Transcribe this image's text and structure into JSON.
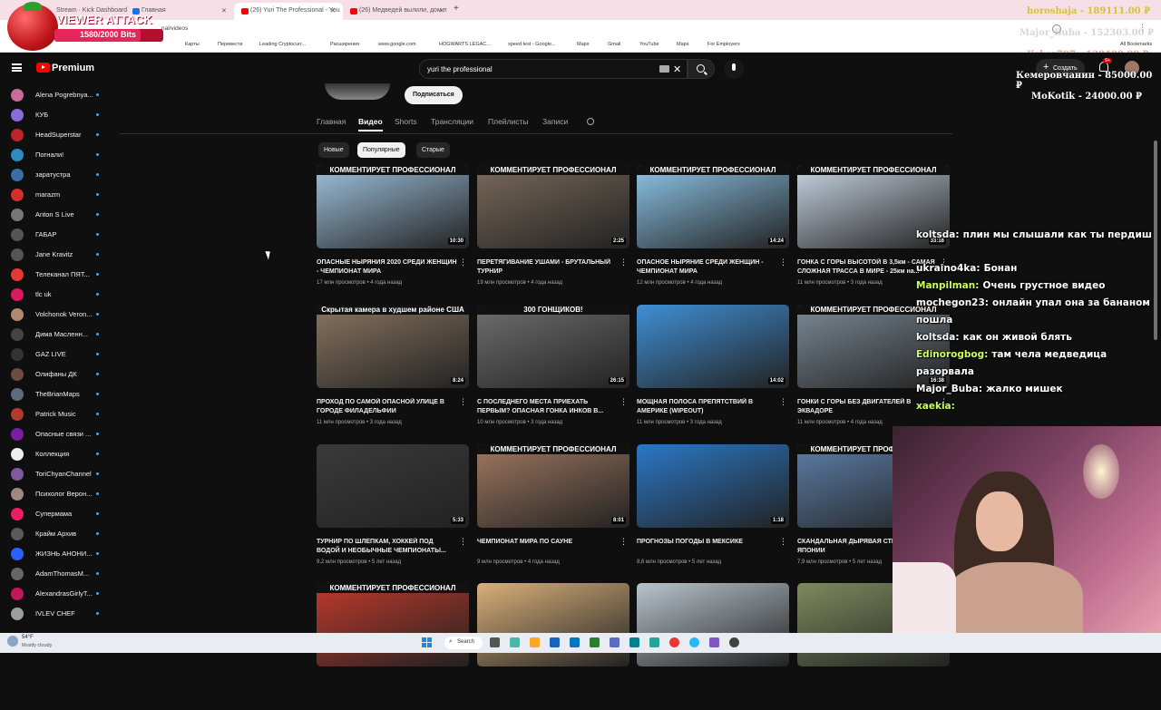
{
  "browser": {
    "tabs": [
      {
        "label": "Stream · Kick Dashboard",
        "active": false
      },
      {
        "label": "Главная",
        "active": false
      },
      {
        "label": "(26) Yuri The Professional - You",
        "active": true
      },
      {
        "label": "(26) Медведей вылили, дом п",
        "active": false
      }
    ],
    "url": "nal/videos",
    "bookmarks": [
      "Карты",
      "Перевести",
      "Leading Cryptocurr...",
      "Расширения",
      "www.google.com",
      "HOGWARTS LEGAC...",
      "speed test - Google...",
      "Maps",
      "Gmail",
      "YouTube",
      "Maps",
      "For Employers",
      "All Bookmarks"
    ]
  },
  "overlay": {
    "viewer_attack_title": "VIEWER ATTACK",
    "viewer_attack_bits": "1580/2000 Bits",
    "donations_top": [
      "horoshaja - 189111.00 ₽",
      "Major_Buba - 152303.00 ₽",
      "Jisher797 - 128400.00 ₽"
    ],
    "donations": [
      "Кемеровчанин - 85000.00 ₽",
      "MoKotik - 24000.00 ₽"
    ]
  },
  "youtube": {
    "logo_text": "Premium",
    "search_value": "yuri the professional",
    "create_label": "Создать",
    "notif_count": "9+",
    "subscribe_label": "Подписаться",
    "nav_tabs": [
      "Главная",
      "Видео",
      "Shorts",
      "Трансляции",
      "Плейлисты",
      "Записи"
    ],
    "active_tab": "Видео",
    "chips": [
      "Новые",
      "Популярные",
      "Старые"
    ],
    "active_chip": "Популярные"
  },
  "sidebar": {
    "items": [
      {
        "label": "Alena Pogrebnya...",
        "color": "#c86a9a"
      },
      {
        "label": "КУБ",
        "color": "#8a6cd9"
      },
      {
        "label": "HeadSuperstar",
        "color": "#c0242b"
      },
      {
        "label": "Погнали!",
        "color": "#2e8bc0"
      },
      {
        "label": "заратустра",
        "color": "#3a6ea5"
      },
      {
        "label": "marazm",
        "color": "#d32f2f"
      },
      {
        "label": "Anton S Live",
        "color": "#777777"
      },
      {
        "label": "ГАБАР",
        "color": "#555555"
      },
      {
        "label": "Jane Kravitz",
        "color": "#555555"
      },
      {
        "label": "Телеканал ПЯТ...",
        "color": "#e53935"
      },
      {
        "label": "tlc uk",
        "color": "#d81b60"
      },
      {
        "label": "Volchonok Veron...",
        "color": "#b08a70"
      },
      {
        "label": "Дима Масленн...",
        "color": "#444444"
      },
      {
        "label": "GAZ LIVE",
        "color": "#333333"
      },
      {
        "label": "Олифаны ДК",
        "color": "#6d4c41"
      },
      {
        "label": "TheBrianMaps",
        "color": "#5d6d7e"
      },
      {
        "label": "Patrick Music",
        "color": "#b03a2e"
      },
      {
        "label": "Опасные связи ...",
        "color": "#7b1fa2"
      },
      {
        "label": "Коллекция",
        "color": "#eeeeee"
      },
      {
        "label": "ToriChyanChannel",
        "color": "#7d5a9e"
      },
      {
        "label": "Психолог Верон...",
        "color": "#a1887f"
      },
      {
        "label": "Супермама",
        "color": "#e91e63"
      },
      {
        "label": "Крайм Архив",
        "color": "#5a5a5a"
      },
      {
        "label": "ЖИЗНЬ АНОНИ...",
        "color": "#2962ff"
      },
      {
        "label": "AdamThomasM...",
        "color": "#666666"
      },
      {
        "label": "AlexandrasGirlyT...",
        "color": "#c2185b"
      },
      {
        "label": "IVLEV CHEF",
        "color": "#9e9e9e"
      }
    ]
  },
  "videos": [
    {
      "head": "КОММЕНТИРУЕТ ПРОФЕССИОНАЛ",
      "title": "ОПАСНЫЕ НЫРЯНИЯ 2020 СРЕДИ ЖЕНЩИН - ЧЕМПИОНАТ МИРА",
      "meta": "17 млн просмотров • 4 года назад",
      "dur": "10:30",
      "bg": "#9fc3df"
    },
    {
      "head": "КОММЕНТИРУЕТ ПРОФЕССИОНАЛ",
      "title": "ПЕРЕТЯГИВАНИЕ УШАМИ - БРУТАЛЬНЫЙ ТУРНИР",
      "meta": "19 млн просмотров • 4 года назад",
      "dur": "2:25",
      "bg": "#7a6a5a"
    },
    {
      "head": "КОММЕНТИРУЕТ ПРОФЕССИОНАЛ",
      "title": "ОПАСНОЕ НЫРЯНИЕ СРЕДИ ЖЕНЩИН - ЧЕМПИОНАТ МИРА",
      "meta": "12 млн просмотров • 4 года назад",
      "dur": "14:24",
      "bg": "#8ec6ea"
    },
    {
      "head": "КОММЕНТИРУЕТ ПРОФЕССИОНАЛ",
      "title": "ГОНКА С ГОРЫ ВЫСОТОЙ В 3,5км - САМАЯ СЛОЖНАЯ ТРАССА В МИРЕ - 25км на...",
      "meta": "11 млн просмотров • 3 года назад",
      "dur": "33:16",
      "bg": "#c9d6e4"
    },
    {
      "head": "Скрытая камера в худшем районе США",
      "title": "ПРОХОД ПО САМОЙ ОПАСНОЙ УЛИЦЕ В ГОРОДЕ ФИЛАДЕЛЬФИИ",
      "meta": "11 млн просмотров • 3 года назад",
      "dur": "8:24",
      "bg": "#8a7560"
    },
    {
      "head": "300 ГОНЩИКОВ!",
      "title": "С ПОСЛЕДНЕГО МЕСТА ПРИЕХАТЬ ПЕРВЫМ? ОПАСНАЯ ГОНКА ИНКОВ В...",
      "meta": "10 млн просмотров • 3 года назад",
      "dur": "26:15",
      "bg": "#6f6f6f"
    },
    {
      "head": "",
      "title": "МОЩНАЯ ПОЛОСА ПРЕПЯТСТВИЙ В АМЕРИКЕ (WIPEOUT)",
      "meta": "11 млн просмотров • 3 года назад",
      "dur": "14:02",
      "bg": "#3f8fd6"
    },
    {
      "head": "КОММЕНТИРУЕТ ПРОФЕССИОНАЛ",
      "title": "ГОНКИ С ГОРЫ БЕЗ ДВИГАТЕЛЕЙ В ЭКВАДОРЕ",
      "meta": "11 млн просмотров • 4 года назад",
      "dur": "16:38",
      "bg": "#7b8a96"
    },
    {
      "head": "",
      "title": "ТУРНИР ПО ШЛЕПКАМ, ХОККЕЙ ПОД ВОДОЙ И НЕОБЫЧНЫЕ ЧЕМПИОНАТЫ...",
      "meta": "9,2 млн просмотров • 5 лет назад",
      "dur": "5:33",
      "bg": "#3a3a3a"
    },
    {
      "head": "КОММЕНТИРУЕТ ПРОФЕССИОНАЛ",
      "title": "ЧЕМПИОНАТ МИРА ПО САУНЕ",
      "meta": "9 млн просмотров • 4 года назад",
      "dur": "8:01",
      "bg": "#a07860"
    },
    {
      "head": "",
      "title": "ПРОГНОЗЫ ПОГОДЫ В МЕКСИКЕ",
      "meta": "8,6 млн просмотров • 5 лет назад",
      "dur": "1:18",
      "bg": "#2b78c6"
    },
    {
      "head": "КОММЕНТИРУЕТ ПРОФЕССИОНАЛ",
      "title": "СКАНДАЛЬНАЯ ДЫРЯВАЯ СТЕНА В ЯПОНИИ",
      "meta": "7,9 млн просмотров • 5 лет назад",
      "dur": "",
      "bg": "#5c7ea8"
    },
    {
      "head": "КОММЕНТИРУЕТ ПРОФЕССИОНАЛ",
      "title": "",
      "meta": "",
      "dur": "",
      "bg": "#c0392b"
    },
    {
      "head": "",
      "title": "",
      "meta": "",
      "dur": "",
      "bg": "#d9b07a"
    },
    {
      "head": "",
      "title": "",
      "meta": "",
      "dur": "",
      "bg": "#b8c4cc"
    },
    {
      "head": "",
      "title": "",
      "meta": "",
      "dur": "",
      "bg": "#7d8a5d"
    }
  ],
  "chat": [
    {
      "user": "koltsda:",
      "msg": "плин мы слышали как ты пердиш",
      "ucolor": "#ffffff"
    },
    {
      "user": "ukraino4ka:",
      "msg": "Бонан",
      "ucolor": "#ffffff"
    },
    {
      "user": "Manpilman:",
      "msg": "Очень грустное видео",
      "ucolor": "#c8ff5a"
    },
    {
      "user": "mochegon23:",
      "msg": "онлайн упал она за бананом пошла",
      "ucolor": "#ffffff"
    },
    {
      "user": "koltsda:",
      "msg": "как он живой блять",
      "ucolor": "#ffffff"
    },
    {
      "user": "Edinorogbog:",
      "msg": "там чела медведица разорвала",
      "ucolor": "#c8ff5a"
    },
    {
      "user": "Major_Buba:",
      "msg": "жалко мишек",
      "ucolor": "#ffffff"
    },
    {
      "user": "xaekia:",
      "msg": "",
      "ucolor": "#c8ff5a"
    }
  ],
  "taskbar": {
    "weather_temp": "54°F",
    "weather_text": "Mostly cloudy",
    "search_label": "Search"
  }
}
